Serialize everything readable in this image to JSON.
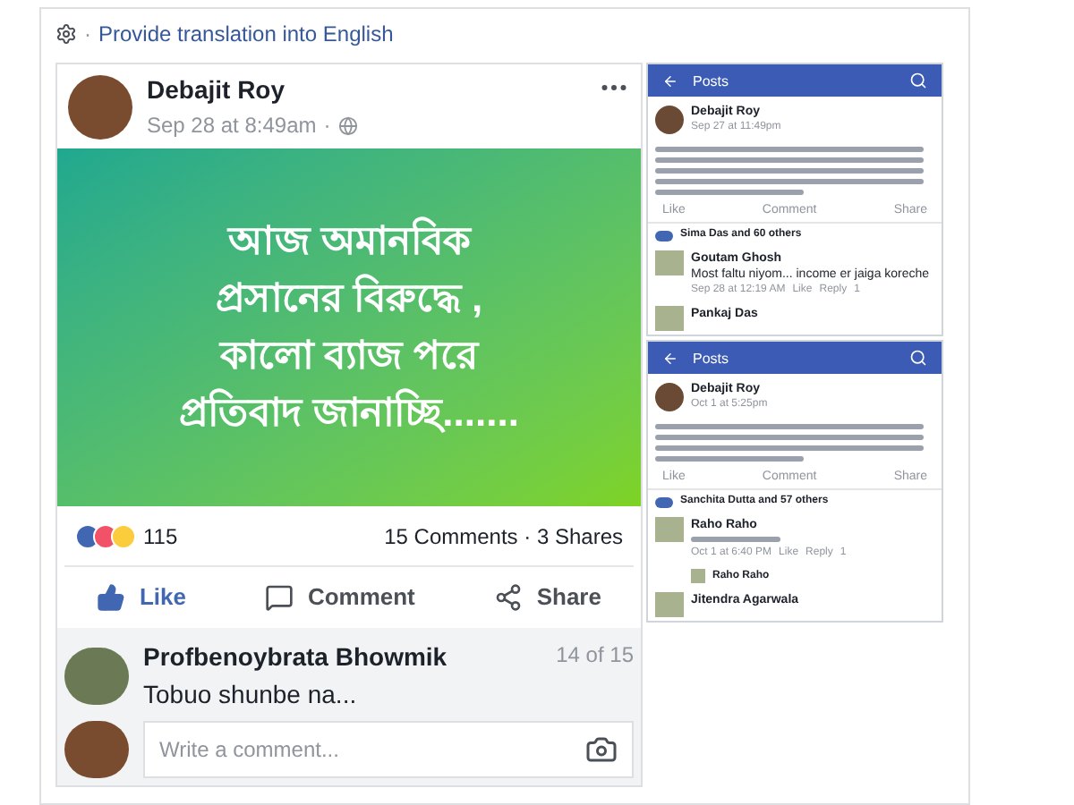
{
  "separator": "·",
  "translate_link": "Provide translation into English",
  "post": {
    "author": "Debajit Roy",
    "time": "Sep 28 at 8:49am",
    "image_text": "আজ অমানবিক প্রসানের বিরুদ্ধে , কালো ব্যাজ পরে প্রতিবাদ জানাচ্ছি.......",
    "reactions_count": "115",
    "stats": "15 Comments · 3 Shares",
    "actions": [
      {
        "kind": "like",
        "label": "Like",
        "selected": true
      },
      {
        "kind": "comment",
        "label": "Comment",
        "selected": false
      },
      {
        "kind": "share",
        "label": "Share",
        "selected": false
      }
    ],
    "comment": {
      "author": "Profbenoybrata Bhowmik",
      "text": "Tobuo shunbe na...",
      "position": "14 of 15"
    },
    "comment_input": {
      "placeholder": "Write a comment..."
    }
  },
  "phone_screenshots": [
    {
      "title": "Posts",
      "author": "Debajit Roy",
      "time": "Sep 27 at 11:49pm",
      "actions": [
        "Like",
        "Comment",
        "Share"
      ],
      "reactions": "Sima Das and 60 others",
      "comments": [
        {
          "kind": "comment",
          "author": "Goutam Ghosh",
          "text": "Most faltu niyom... income er jaiga koreche",
          "time": "Sep 28 at 12:19 AM",
          "like": "Like",
          "reply": "Reply",
          "count": "1"
        },
        {
          "kind": "comment",
          "author": "Pankaj Das"
        }
      ]
    },
    {
      "title": "Posts",
      "author": "Debajit Roy",
      "time": "Oct 1 at 5:25pm",
      "actions": [
        "Like",
        "Comment",
        "Share"
      ],
      "reactions": "Sanchita Dutta and 57 others",
      "comments": [
        {
          "kind": "comment",
          "author": "Raho Raho",
          "time": "Oct 1 at 6:40 PM",
          "like": "Like",
          "reply": "Reply",
          "count": "1"
        },
        {
          "kind": "reply",
          "author": "Raho Raho"
        },
        {
          "kind": "comment",
          "author": "Jitendra Agarwala"
        }
      ]
    }
  ]
}
